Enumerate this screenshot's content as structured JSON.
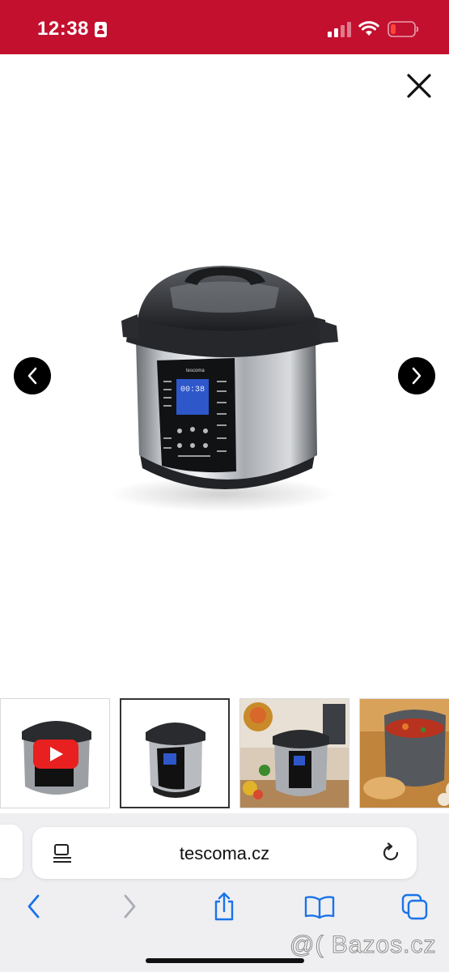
{
  "status_bar": {
    "time": "12:38",
    "background": "#c3102f"
  },
  "gallery": {
    "main_image_alt": "Tescoma pressure cooker",
    "device_display": "00:38",
    "device_brand": "tescoma",
    "thumbnails": [
      {
        "icon": "youtube-play-icon"
      },
      {
        "icon": "product-image"
      },
      {
        "icon": "kitchen-scene-image"
      },
      {
        "icon": "cooked-food-image"
      }
    ],
    "active_thumbnail": 1
  },
  "browser": {
    "url": "tescoma.cz"
  },
  "watermark": "@( Bazos.cz"
}
